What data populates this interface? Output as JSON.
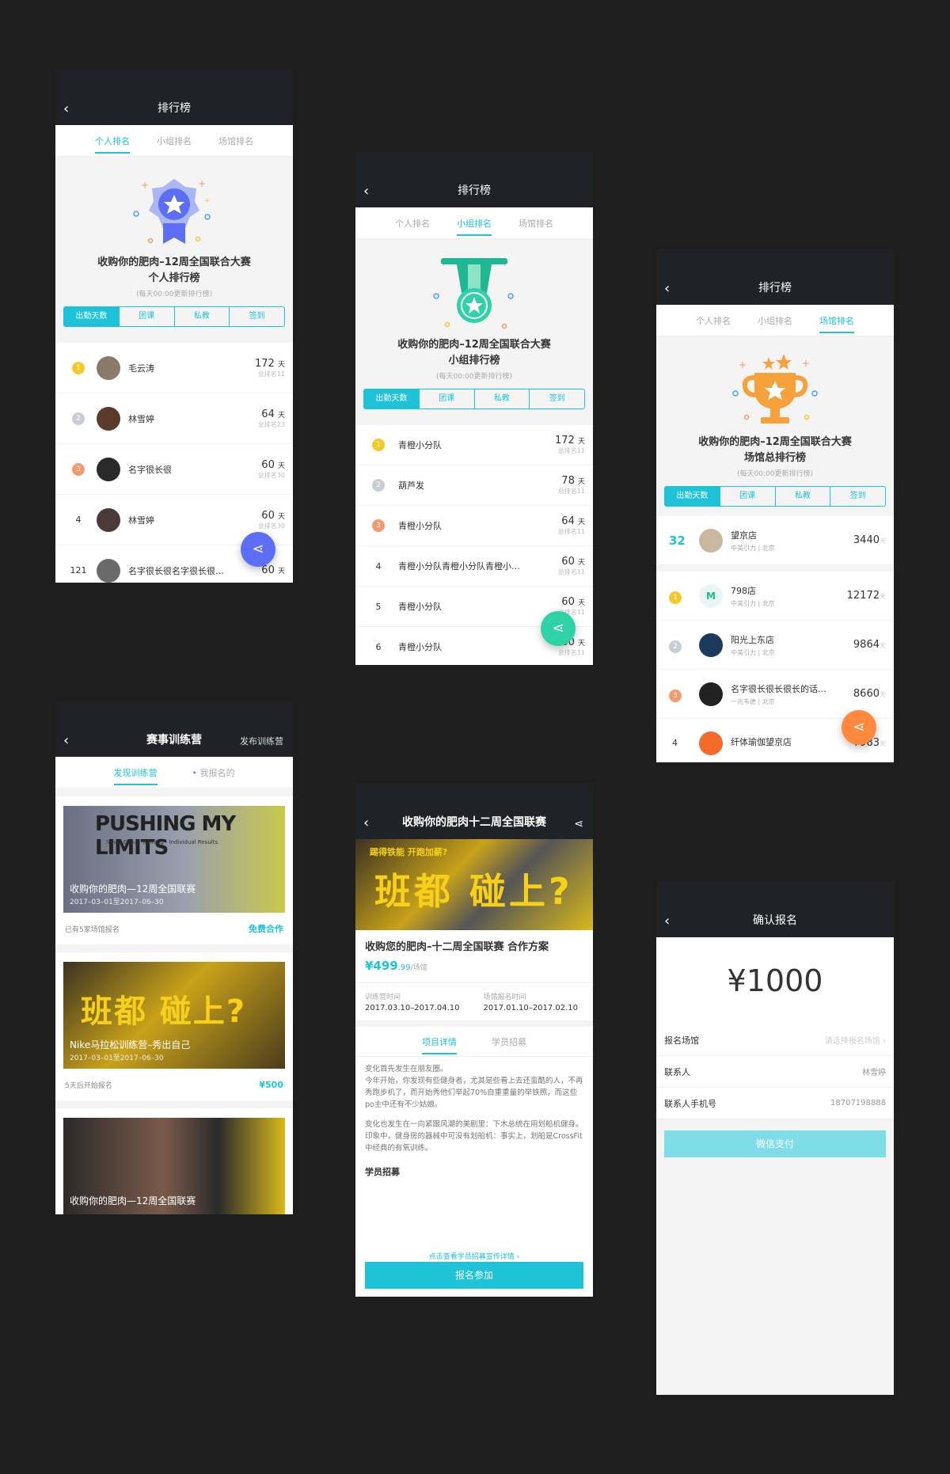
{
  "colors": {
    "accent": "#1ec3d8",
    "page_bg": "#1e1e1e",
    "navbar": "#202227",
    "fab_blue": "#5b6ef5",
    "fab_green": "#2fd1a6",
    "fab_orange": "#ff8a3d",
    "gold": "#f7c82a"
  },
  "icons": {
    "back": "‹",
    "share": "share-icon"
  },
  "screen1": {
    "title": "排行榜",
    "tabs": [
      "个人排名",
      "小组排名",
      "场馆排名"
    ],
    "event_title": "收购你的肥肉–12周全国联合大赛",
    "board_title": "个人排行榜",
    "note": "(每天00:00更新排行榜)",
    "segments": [
      "出勤天数",
      "团课",
      "私教",
      "签到"
    ],
    "rows": [
      {
        "rank": "1",
        "name": "毛云涛",
        "value": "172",
        "unit": "天",
        "total": "总排名11"
      },
      {
        "rank": "2",
        "name": "林雪婷",
        "value": "64",
        "unit": "天",
        "total": "总排名23"
      },
      {
        "rank": "3",
        "name": "名字很长很",
        "value": "60",
        "unit": "天",
        "total": "总排名30"
      },
      {
        "rank": "4",
        "name": "林雪婷",
        "value": "60",
        "unit": "天",
        "total": "总排名30"
      },
      {
        "rank": "121",
        "name": "名字很长很名字很长很…",
        "value": "60",
        "unit": "天",
        "total": ""
      }
    ]
  },
  "screen2": {
    "title": "排行榜",
    "tabs": [
      "个人排名",
      "小组排名",
      "场馆排名"
    ],
    "event_title": "收购你的肥肉–12周全国联合大赛",
    "board_title": "小组排行榜",
    "note": "(每天00:00更新排行榜)",
    "segments": [
      "出勤天数",
      "团课",
      "私教",
      "签到"
    ],
    "rows": [
      {
        "rank": "1",
        "name": "青橙小分队",
        "value": "172",
        "unit": "天",
        "total": "总排名11"
      },
      {
        "rank": "2",
        "name": "葫芦发",
        "value": "78",
        "unit": "天",
        "total": "总排名11"
      },
      {
        "rank": "3",
        "name": "青橙小分队",
        "value": "64",
        "unit": "天",
        "total": "总排名11"
      },
      {
        "rank": "4",
        "name": "青橙小分队青橙小分队青橙小…",
        "value": "60",
        "unit": "天",
        "total": "总排名11"
      },
      {
        "rank": "5",
        "name": "青橙小分队",
        "value": "60",
        "unit": "天",
        "total": "总排名11"
      },
      {
        "rank": "6",
        "name": "青橙小分队",
        "value": "60",
        "unit": "天",
        "total": "总排名11"
      }
    ]
  },
  "screen3": {
    "title": "排行榜",
    "tabs": [
      "个人排名",
      "小组排名",
      "场馆排名"
    ],
    "event_title": "收购你的肥肉–12周全国联合大赛",
    "board_title": "场馆总排行榜",
    "note": "(每天00:00更新排行榜)",
    "segments": [
      "出勤天数",
      "团课",
      "私教",
      "签到"
    ],
    "mine": {
      "rank": "32",
      "name": "望京店",
      "sub": "中美引力 | 北京",
      "score": "3440",
      "unit": "天"
    },
    "rows": [
      {
        "rank": "1",
        "name": "798店",
        "sub": "中美引力 | 北京",
        "score": "12172",
        "unit": "天"
      },
      {
        "rank": "2",
        "name": "阳光上东店",
        "sub": "中美引力 | 北京",
        "score": "9864",
        "unit": "天"
      },
      {
        "rank": "3",
        "name": "名字很长很长很长的话…",
        "sub": "一兆韦德 | 北京",
        "score": "8660",
        "unit": "天"
      },
      {
        "rank": "4",
        "name": "纤体瑜伽望京店",
        "sub": "",
        "score": "7983",
        "unit": "天"
      }
    ]
  },
  "screen4": {
    "title": "赛事训练营",
    "right_action": "发布训练营",
    "tabs": [
      "发现训练营",
      "我报名的"
    ],
    "cards": [
      {
        "img_text": "PUSHING MY LIMITS",
        "img_sub": "Small Group Training · Individual Results",
        "title": "收购你的肥肉—12周全国联赛",
        "dates": "2017–03–01至2017–06–30",
        "meta": "已有5家场馆报名",
        "action": "免费合作"
      },
      {
        "img_text": "班都 碰上?",
        "img_sub": "",
        "title": "Nike马拉松训练营–秀出自己",
        "dates": "2017–03–01至2017–06–30",
        "meta": "5天后开始报名",
        "action": "¥500"
      },
      {
        "img_text": "",
        "img_sub": "",
        "title": "收购你的肥肉—12周全国联赛",
        "dates": "",
        "meta": "",
        "action": ""
      }
    ]
  },
  "screen5": {
    "title": "收购你的肥肉十二周全国联赛",
    "banner_text": "班都 碰上?",
    "banner_sub": "踢得铁能 开跑加薪?",
    "plan_title": "收购您的肥肉–十二周全国联赛 合作方案",
    "price": "¥499",
    "price_small": ".99",
    "price_unit": "/场馆",
    "camp_time_label": "训练营时间",
    "camp_time": "2017.03.10–2017.04.10",
    "signup_time_label": "场馆报名时间",
    "signup_time": "2017.01.10–2017.02.10",
    "tabs": [
      "项目详情",
      "学员招募"
    ],
    "para1": "变化首先发生在朋友圈。\n今年开始，你发现有些健身者，尤其是些看上去还蛮酷的人，不再秀跑步机了，而开始秀他们举起70%自重重量的举铁照，而这些po主中还有不少姑娘。",
    "para2": "变化也发生在一向紧跟风潮的美剧里：下木总统在用划船机健身。印象中，健身房的器械中可没有划船机：事实上，划船是CrossFit中经典的有氧训练。",
    "recruit_label": "学员招募",
    "recruit_link": "点击查看学员招募宣传详情 ›",
    "cta": "报名参加"
  },
  "screen6": {
    "title": "确认报名",
    "amount": "¥1000",
    "fields": [
      {
        "label": "报名场馆",
        "value": "请选择报名场馆 ›"
      },
      {
        "label": "联系人",
        "value": "林雪婷"
      },
      {
        "label": "联系人手机号",
        "value": "18707198888"
      }
    ],
    "pay_button": "微信支付"
  }
}
